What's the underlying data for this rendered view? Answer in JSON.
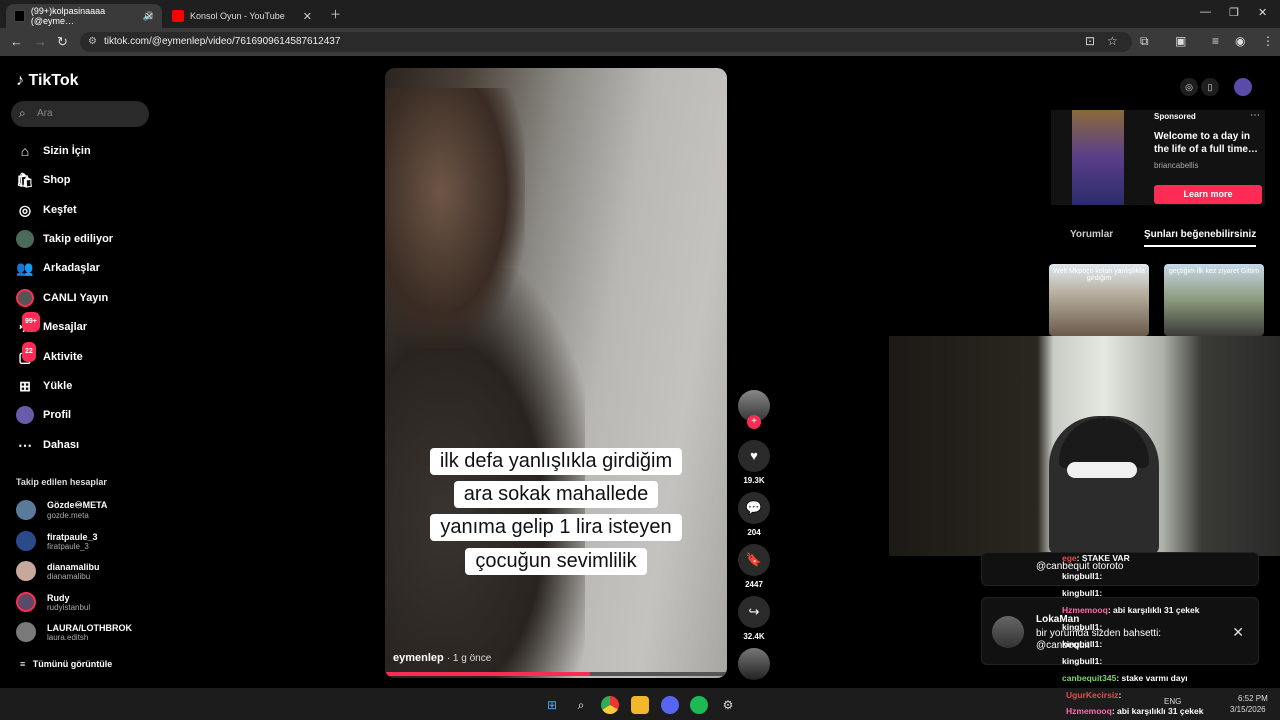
{
  "browser": {
    "tabs": [
      {
        "label": "(99+)kolpasinaaaa (@eyme…",
        "active": true
      },
      {
        "label": "Konsol Oyun - YouTube",
        "active": false
      }
    ],
    "url": "tiktok.com/@eymenlep/video/7616909614587612437"
  },
  "sidebar": {
    "logo": "TikTok",
    "search_placeholder": "Ara",
    "items": [
      {
        "label": "Sizin İçin",
        "icon": "home-icon"
      },
      {
        "label": "Shop",
        "icon": "shop-icon"
      },
      {
        "label": "Keşfet",
        "icon": "compass-icon"
      },
      {
        "label": "Takip ediliyor",
        "icon": "avatar-icon"
      },
      {
        "label": "Arkadaşlar",
        "icon": "friends-icon"
      },
      {
        "label": "CANLI Yayın",
        "icon": "live-icon"
      },
      {
        "label": "Mesajlar",
        "icon": "message-icon",
        "badge": "99+"
      },
      {
        "label": "Aktivite",
        "icon": "activity-icon",
        "badge": "22"
      },
      {
        "label": "Yükle",
        "icon": "upload-icon"
      },
      {
        "label": "Profil",
        "icon": "profile-icon"
      },
      {
        "label": "Dahası",
        "icon": "more-icon"
      }
    ],
    "following_title": "Takip edilen hesaplar",
    "following": [
      {
        "name": "Gözde♾META",
        "handle": "gozde.meta"
      },
      {
        "name": "firatpaule_3",
        "handle": "firatpaule_3"
      },
      {
        "name": "dianamalibu",
        "handle": "dianamalibu"
      },
      {
        "name": "Rudy",
        "handle": "rudyistanbul"
      },
      {
        "name": "LAURA/LOTHBROK",
        "handle": "laura.editsh"
      }
    ],
    "see_all": "Tümünü görüntüle"
  },
  "video": {
    "caption": [
      "ilk defa yanlışlıkla girdiğim",
      "ara sokak mahallede",
      "yanıma gelip 1 lira isteyen",
      "çocuğun sevimlilik"
    ],
    "author": "eymenlep",
    "time": "· 1 g önce",
    "progress": 0.6,
    "likes": "19.3K",
    "comments": "204",
    "saves": "2447",
    "shares": "32.4K"
  },
  "right": {
    "sponsored_label": "Sponsored",
    "ad_title": "Welcome to a day in the life of a full time…",
    "ad_author": "briancabellis",
    "ad_button": "Learn more",
    "tabs": [
      "Yorumlar",
      "Şunları beğenebilirsiniz"
    ],
    "thumb1_text": "Welt Mkpoço kolan yanlışlıkla girdiğim",
    "thumb2_text": "geçtiğim ilk kez ziyaret Gittim"
  },
  "overlay": {
    "chat": [
      {
        "name": "ege",
        "text": ": STAKE VAR"
      },
      {
        "name": "@canbequit",
        "text": "otoroto"
      },
      {
        "name": "kingbull1",
        "text": ":"
      },
      {
        "name": "kingbull1",
        "text": ":"
      },
      {
        "name": "Hzmemooq",
        "text": ": abi karşılıklı 31 çekek"
      },
      {
        "name": "kingbull1",
        "text": ":"
      },
      {
        "name": "kingbull1",
        "text": ":"
      },
      {
        "name": "kingbull1",
        "text": ":"
      },
      {
        "name": "canbequit345",
        "text": ": stake varmı dayı"
      },
      {
        "name": "UgurKecirsiz",
        "text": ":"
      },
      {
        "name": "Hzmemooq",
        "text": ": abi karşılıklı 31 çekek"
      }
    ],
    "notif_name": "LokaMan",
    "notif_line1": "bir yorumda sizden bahsetti:",
    "notif_line2": "@canbequit"
  },
  "taskbar": {
    "lang": "ENG",
    "time": "6:52 PM",
    "date": "3/15/2026"
  }
}
